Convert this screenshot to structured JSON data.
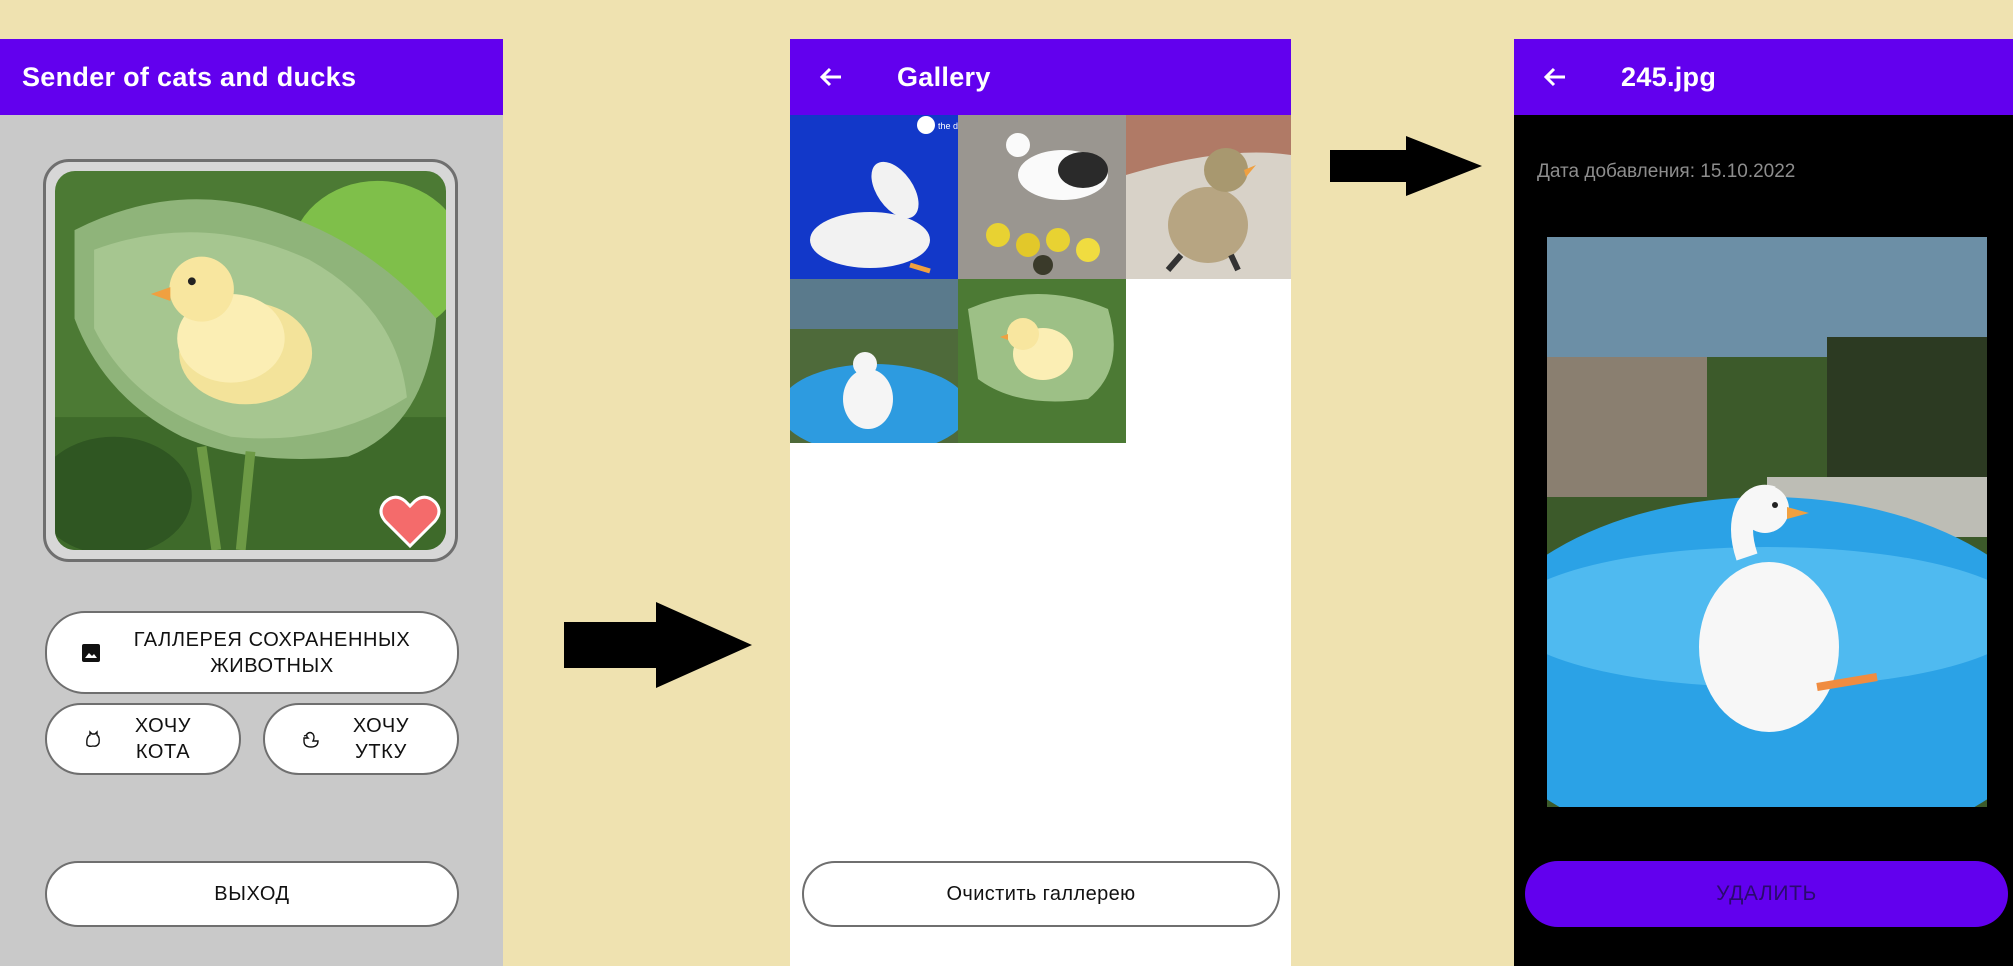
{
  "screen_main": {
    "title": "Sender of cats and ducks",
    "gallery_button": "Галлерея сохраненных животных",
    "cat_button": "Хочу кота",
    "duck_button": "Хочу утку",
    "exit_button": "Выход"
  },
  "screen_gallery": {
    "title": "Gallery",
    "clear_button": "Очистить галлерею",
    "thumb_badge": "the dodo"
  },
  "screen_detail": {
    "title": "245.jpg",
    "date_label": "Дата добавления: 15.10.2022",
    "delete_button": "Удалить"
  },
  "colors": {
    "primary": "#6200ee",
    "heart": "#f46b6b",
    "background": "#efe2b0"
  },
  "icons": [
    "back-arrow-icon",
    "heart-icon",
    "image-icon",
    "cat-icon",
    "duck-icon"
  ]
}
